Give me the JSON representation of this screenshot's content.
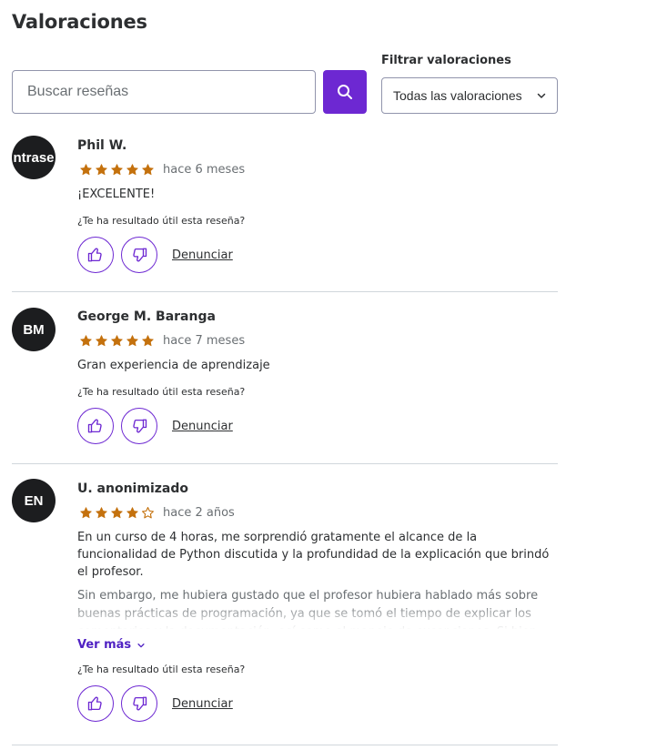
{
  "page": {
    "title": "Valoraciones"
  },
  "search": {
    "placeholder": "Buscar reseñas",
    "value": ""
  },
  "filter": {
    "label": "Filtrar valoraciones",
    "selected": "Todas las valoraciones"
  },
  "colors": {
    "accent": "#6d28d2",
    "star": "#c4710d",
    "avatar_bg": "#1c1d1f",
    "link": "#5022c3"
  },
  "reviews": [
    {
      "avatar": "ntrase",
      "name": "Phil W.",
      "rating": 5,
      "date": "hace 6 meses",
      "text": "¡EXCELENTE!",
      "helpful_question": "¿Te ha resultado útil esta reseña?",
      "report_label": "Denunciar"
    },
    {
      "avatar": "BM",
      "name": "George M. Baranga",
      "rating": 5,
      "date": "hace 7 meses",
      "text": "Gran experiencia de aprendizaje",
      "helpful_question": "¿Te ha resultado útil esta reseña?",
      "report_label": "Denunciar"
    },
    {
      "avatar": "EN",
      "name": "U. anonimizado",
      "rating": 4,
      "date": "hace 2 años",
      "text": "En un curso de 4 horas, me sorprendió gratamente el alcance de la funcionalidad de Python discutida y la profundidad de la explicación que brindó el profesor.",
      "text_more": "Sin embargo, me hubiera gustado que el profesor hubiera hablado más sobre buenas prácticas de programación, ya que se tomó el tiempo de explicar los comentarios y la documentación, así como el manejo de excepciones. Si bien",
      "see_more_label": "Ver más",
      "helpful_question": "¿Te ha resultado útil esta reseña?",
      "report_label": "Denunciar"
    }
  ]
}
